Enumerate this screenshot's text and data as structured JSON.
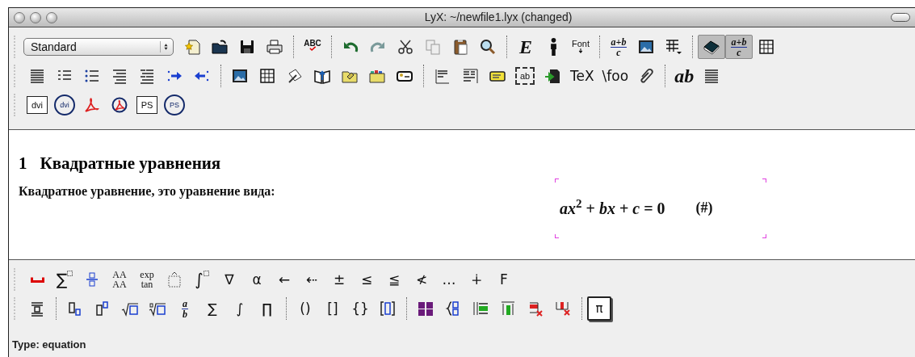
{
  "window": {
    "title": "LyX: ~/newfile1.lyx (changed)"
  },
  "layout_select": {
    "value": "Standard"
  },
  "main_toolbar": [
    [
      [
        {
          "kind": "new"
        },
        {
          "kind": "open"
        },
        {
          "kind": "save"
        },
        {
          "kind": "print"
        }
      ],
      [
        {
          "kind": "spell",
          "label": "ABC"
        }
      ],
      [
        {
          "kind": "undo"
        },
        {
          "kind": "redo"
        },
        {
          "kind": "cut"
        },
        {
          "kind": "copy"
        },
        {
          "kind": "paste"
        },
        {
          "kind": "find"
        }
      ],
      [
        {
          "kind": "italic",
          "label": "E"
        },
        {
          "kind": "person"
        },
        {
          "kind": "font",
          "label": "Font"
        }
      ],
      [
        {
          "kind": "fraction",
          "top": "a+b",
          "bottom": "c"
        },
        {
          "kind": "image"
        },
        {
          "kind": "tablemenu"
        }
      ],
      [
        {
          "kind": "book",
          "pressed": true
        },
        {
          "kind": "fraction",
          "top": "a+b",
          "bottom": "c",
          "pressed": true
        },
        {
          "kind": "table",
          "pressed": false
        }
      ]
    ],
    [
      [
        {
          "kind": "justify"
        },
        {
          "kind": "enum"
        },
        {
          "kind": "bullets"
        },
        {
          "kind": "desc"
        },
        {
          "kind": "list"
        },
        {
          "kind": "indent"
        },
        {
          "kind": "outdent"
        }
      ],
      [
        {
          "kind": "image"
        },
        {
          "kind": "table"
        },
        {
          "kind": "pen"
        },
        {
          "kind": "bookarrow"
        },
        {
          "kind": "folder"
        },
        {
          "kind": "foldercolor"
        },
        {
          "kind": "tag"
        }
      ],
      [
        {
          "kind": "floatfig"
        },
        {
          "kind": "floatwide"
        },
        {
          "kind": "note"
        },
        {
          "kind": "dashed",
          "label": "ab"
        },
        {
          "kind": "arrowdoc"
        },
        {
          "kind": "text",
          "label": "TeX"
        },
        {
          "kind": "text",
          "label": "\\foo"
        },
        {
          "kind": "clip"
        }
      ],
      [
        {
          "kind": "italic",
          "label": "ab"
        },
        {
          "kind": "justify"
        }
      ]
    ],
    [
      [
        {
          "kind": "boxed",
          "label": "dvi"
        },
        {
          "kind": "circled",
          "label": "dvi"
        },
        {
          "kind": "pdf"
        },
        {
          "kind": "pdfcircle"
        },
        {
          "kind": "boxed",
          "label": "PS"
        },
        {
          "kind": "circled",
          "label": "PS"
        }
      ]
    ]
  ],
  "document": {
    "section_number": "1",
    "section_title": "Квадратные уравнения",
    "paragraph": "Квадратное уравнение, это уравнение вида:",
    "equation": "*ax*$^{2}$ + *bx* + *c* = 0",
    "equation_label": "(#)"
  },
  "math_toolbar": [
    [
      [
        {
          "kind": "space"
        },
        {
          "kind": "glyphbox",
          "label": "∑"
        },
        {
          "kind": "fracbox"
        },
        {
          "kind": "stack",
          "top": "AA",
          "bottom": "AA"
        },
        {
          "kind": "stack",
          "top": "exp",
          "bottom": "tan"
        },
        {
          "kind": "accent"
        },
        {
          "kind": "glyphbox",
          "label": "∫"
        },
        {
          "kind": "text",
          "label": "∇"
        },
        {
          "kind": "text",
          "label": "α"
        },
        {
          "kind": "text",
          "label": "←"
        },
        {
          "kind": "text",
          "label": "⇠"
        },
        {
          "kind": "text",
          "label": "±"
        },
        {
          "kind": "text",
          "label": "≤"
        },
        {
          "kind": "text",
          "label": "≦"
        },
        {
          "kind": "text",
          "label": "≮"
        },
        {
          "kind": "text",
          "label": "…"
        },
        {
          "kind": "text",
          "label": "∔"
        },
        {
          "kind": "text",
          "label": "F"
        }
      ]
    ],
    [
      [
        {
          "kind": "alignc"
        }
      ],
      [
        {
          "kind": "sub"
        },
        {
          "kind": "sup"
        },
        {
          "kind": "sqrt"
        },
        {
          "kind": "root"
        },
        {
          "kind": "fraction",
          "top": "a",
          "bottom": "b"
        },
        {
          "kind": "text",
          "label": "∑"
        },
        {
          "kind": "text",
          "label": "∫"
        },
        {
          "kind": "text",
          "label": "∏"
        }
      ],
      [
        {
          "kind": "text",
          "label": "()"
        },
        {
          "kind": "text",
          "label": "[]"
        },
        {
          "kind": "text",
          "label": "{}"
        },
        {
          "kind": "brackets"
        }
      ],
      [
        {
          "kind": "matrix"
        },
        {
          "kind": "cases"
        },
        {
          "kind": "addrow"
        },
        {
          "kind": "addcol"
        },
        {
          "kind": "delrow"
        },
        {
          "kind": "delcol"
        }
      ],
      [
        {
          "kind": "boxed",
          "label": "π",
          "pressed": true
        }
      ]
    ]
  ],
  "status_bar": "Type: equation"
}
